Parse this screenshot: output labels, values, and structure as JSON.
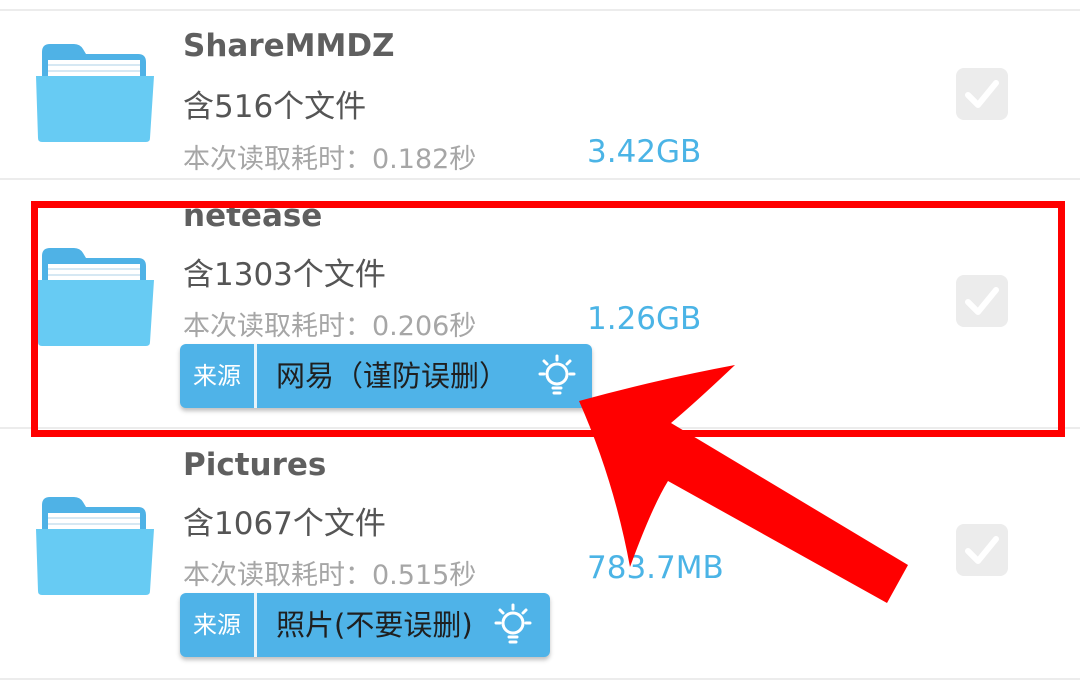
{
  "files": [
    {
      "name": "ShareMMDZ",
      "count": "含516个文件",
      "time": "本次读取耗时：0.182秒",
      "size": "3.42GB",
      "checked": true
    },
    {
      "name": "netease",
      "count": "含1303个文件",
      "time": "本次读取耗时：0.206秒",
      "size": "1.26GB",
      "checked": true,
      "source_tag": "来源",
      "source_text": "网易（谨防误删）"
    },
    {
      "name": "Pictures",
      "count": "含1067个文件",
      "time": "本次读取耗时：0.515秒",
      "size": "783.7MB",
      "checked": true,
      "source_tag": "来源",
      "source_text": "照片(不要误删)"
    }
  ],
  "icons": {
    "folder": "folder-icon",
    "checkbox": "checkmark-icon",
    "hint": "lightbulb-icon"
  },
  "colors": {
    "accent": "#4bb4e6",
    "source_badge": "#4fb3e8",
    "highlight": "#ff0000",
    "folder": "#5cc3f0"
  }
}
